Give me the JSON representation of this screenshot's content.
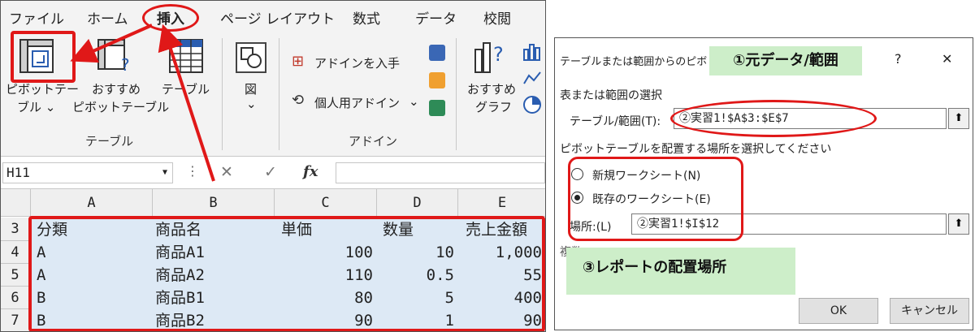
{
  "excel": {
    "tabs": [
      "ファイル",
      "ホーム",
      "挿入",
      "ページ レイアウト",
      "数式",
      "データ",
      "校閲"
    ],
    "ribbon": {
      "pivot_line1": "ピボットテー",
      "pivot_line2": "ブル ⌄",
      "rec_pivot_line1": "おすすめ",
      "rec_pivot_line2": "ピボットテーブル",
      "table_label": "テーブル",
      "figure_label": "図",
      "figure_caret": "⌄",
      "addin_get": "アドインを入手",
      "addin_personal": "個人用アドイン",
      "addin_caret": "⌄",
      "rec_chart_line1": "おすすめ",
      "rec_chart_line2": "グラフ",
      "group_table": "テーブル",
      "group_addin": "アドイン"
    },
    "formula_bar": {
      "name_box": "H11",
      "cancel": "✕",
      "enter": "✓",
      "fx": "fx"
    },
    "columns": [
      "A",
      "B",
      "C",
      "D",
      "E"
    ],
    "row_numbers": [
      "3",
      "4",
      "5",
      "6",
      "7"
    ],
    "rows": [
      [
        "分類",
        "商品名",
        "単価",
        "数量",
        "売上金額"
      ],
      [
        "A",
        "商品A1",
        "100",
        "10",
        "1,000"
      ],
      [
        "A",
        "商品A2",
        "110",
        "0.5",
        "55"
      ],
      [
        "B",
        "商品B1",
        "80",
        "5",
        "400"
      ],
      [
        "B",
        "商品B2",
        "90",
        "1",
        "90"
      ]
    ]
  },
  "dialog": {
    "title": "テーブルまたは範囲からのピボ",
    "help": "?",
    "close": "✕",
    "section_source": "表または範囲の選択",
    "range_label": "テーブル/範囲(T):",
    "range_value": "②実習1!$A$3:$E$7",
    "section_place": "ピボットテーブルを配置する場所を選択してください",
    "radio_new": "新規ワークシート(N)",
    "radio_existing": "既存のワークシート(E)",
    "location_label": "場所:(L)",
    "location_value": "②実習1!$I$12",
    "partial_text": "複数",
    "ok": "OK",
    "cancel": "キャンセル"
  },
  "annotations": {
    "note1": "①元データ/範囲",
    "note3": "③レポートの配置場所"
  },
  "colors": {
    "highlight_red": "#e01818",
    "note_green": "#cdeec9",
    "selection_blue": "#dde9f5"
  }
}
